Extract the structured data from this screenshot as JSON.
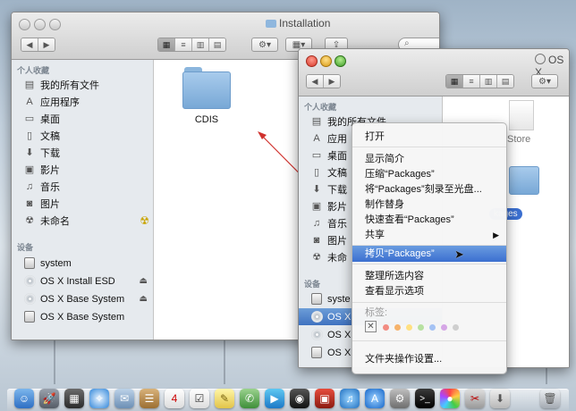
{
  "back_window": {
    "title": "Installation",
    "sidebar": {
      "favorites_header": "个人收藏",
      "favorites": [
        {
          "label": "我的所有文件",
          "icon": "all-files-icon"
        },
        {
          "label": "应用程序",
          "icon": "applications-icon"
        },
        {
          "label": "桌面",
          "icon": "desktop-icon"
        },
        {
          "label": "文稿",
          "icon": "documents-icon"
        },
        {
          "label": "下载",
          "icon": "downloads-icon"
        },
        {
          "label": "影片",
          "icon": "movies-icon"
        },
        {
          "label": "音乐",
          "icon": "music-icon"
        },
        {
          "label": "图片",
          "icon": "pictures-icon"
        },
        {
          "label": "未命名",
          "icon": "radioactive-icon"
        }
      ],
      "devices_header": "设备",
      "devices": [
        {
          "label": "system",
          "icon": "hard-drive-icon"
        },
        {
          "label": "OS X Install ESD",
          "icon": "disk-image-icon"
        },
        {
          "label": "OS X Base System",
          "icon": "disk-image-icon"
        },
        {
          "label": "OS X Base System",
          "icon": "hard-drive-icon"
        }
      ]
    },
    "folder_label": "CDIS"
  },
  "front_window": {
    "title": "OS X",
    "sidebar": {
      "favorites_header": "个人收藏",
      "favorites": [
        {
          "label": "我的所有文件"
        },
        {
          "label": "应用"
        },
        {
          "label": "桌面"
        },
        {
          "label": "文稿"
        },
        {
          "label": "下载"
        },
        {
          "label": "影片"
        },
        {
          "label": "音乐"
        },
        {
          "label": "图片"
        },
        {
          "label": "未命"
        }
      ],
      "devices_header": "设备",
      "devices": [
        {
          "label": "syste"
        },
        {
          "label": "OS X"
        },
        {
          "label": "OS X"
        },
        {
          "label": "OS X"
        }
      ]
    },
    "item_store": "Store",
    "item_packages": "kages"
  },
  "context_menu": {
    "items": [
      {
        "label": "打开"
      },
      {
        "label": "显示简介"
      },
      {
        "label": "压缩“Packages”"
      },
      {
        "label": "将“Packages”刻录至光盘..."
      },
      {
        "label": "制作替身"
      },
      {
        "label": "快速查看“Packages”"
      },
      {
        "label": "共享"
      },
      {
        "label": "拷贝“Packages”"
      },
      {
        "label": "整理所选内容"
      },
      {
        "label": "查看显示选项"
      },
      {
        "label": "文件夹操作设置..."
      }
    ],
    "tags_label": "标签:",
    "tag_colors": [
      "#f28b82",
      "#f6b26b",
      "#ffe082",
      "#b7e1a1",
      "#a4c2f4",
      "#d5a6e6",
      "#cfcfcf"
    ],
    "highlight_color": "#3b6fd0"
  },
  "annotation_color": "#d0312d"
}
